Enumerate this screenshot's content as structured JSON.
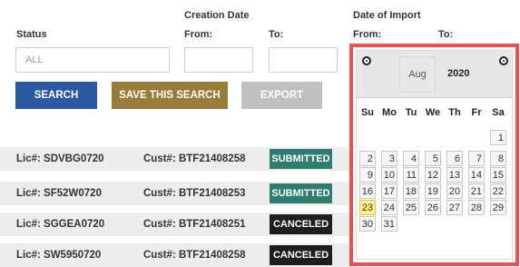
{
  "filters": {
    "status_label": "Status",
    "status_placeholder": "ALL",
    "creation_date_label": "Creation Date",
    "creation_from_label": "From:",
    "creation_to_label": "To:",
    "import_date_label": "Date of Import",
    "import_from_label": "From:",
    "import_to_label": "To:"
  },
  "buttons": {
    "search": "SEARCH",
    "save_search": "SAVE THIS SEARCH",
    "export": "EXPORT"
  },
  "colors": {
    "search": "#2b58a0",
    "save_search": "#9a7c3a",
    "export": "#c0c0c0",
    "submitted": "#2e7d6f",
    "canceled": "#1e1e1e",
    "calendar_highlight_border": "#ee5050"
  },
  "rows": [
    {
      "lic": "Lic#: SDVBG0720",
      "cust": "Cust#: BTF21408258",
      "status": "SUBMITTED",
      "status_kind": "submitted"
    },
    {
      "lic": "Lic#: SF52W0720",
      "cust": "Cust#: BTF21408253",
      "status": "SUBMITTED",
      "status_kind": "submitted"
    },
    {
      "lic": "Lic#: SGGEA0720",
      "cust": "Cust#: BTF21408251",
      "status": "CANCELED",
      "status_kind": "canceled"
    },
    {
      "lic": "Lic#: SW5950720",
      "cust": "Cust#: BTF21408258",
      "status": "CANCELED",
      "status_kind": "canceled"
    }
  ],
  "calendar": {
    "month": "Aug",
    "year": "2020",
    "weekdays": [
      "Su",
      "Mo",
      "Tu",
      "We",
      "Th",
      "Fr",
      "Sa"
    ],
    "first_weekday_index": 6,
    "days_in_month": 31,
    "today": 23,
    "prev_icon": "circle-arrow-prev-icon",
    "next_icon": "circle-arrow-next-icon"
  }
}
